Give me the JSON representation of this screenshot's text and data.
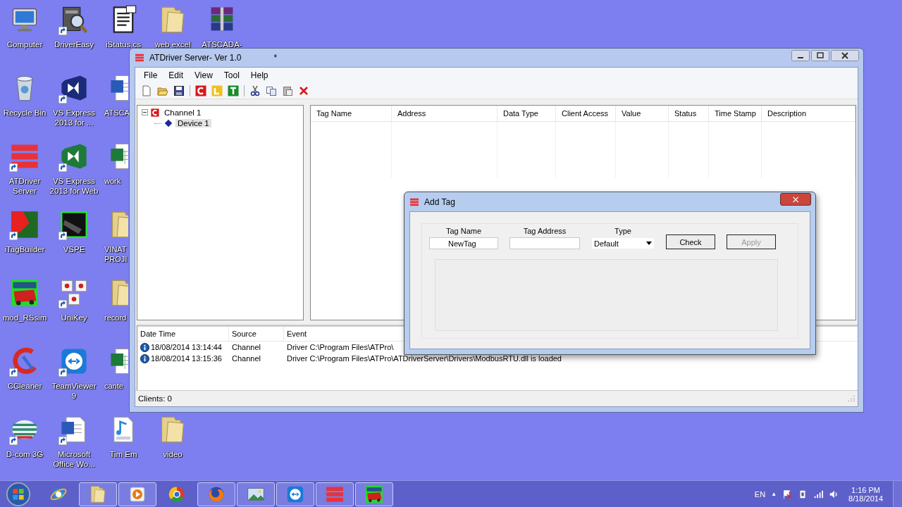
{
  "desktop": {
    "icons": [
      {
        "label": "Computer",
        "kind": "computer",
        "shortcut": false
      },
      {
        "label": "Recycle Bin",
        "kind": "recycle",
        "shortcut": false
      },
      {
        "label": "ATDriver Server",
        "kind": "bars",
        "shortcut": true
      },
      {
        "label": "iTagBuilder",
        "kind": "tagbuilder",
        "shortcut": true
      },
      {
        "label": "mod_RSsim",
        "kind": "mod",
        "shortcut": false
      },
      {
        "label": "CCleaner",
        "kind": "ccleaner",
        "shortcut": true
      },
      {
        "label": "D-com 3G",
        "kind": "globe",
        "shortcut": true
      },
      {
        "label": "DriverEasy",
        "kind": "drivereasy",
        "shortcut": true
      },
      {
        "label": "VS Express 2013 for ...",
        "kind": "vs",
        "shortcut": true
      },
      {
        "label": "VS Express 2013 for Web",
        "kind": "vsweb",
        "shortcut": true
      },
      {
        "label": "VSPE",
        "kind": "vspe",
        "shortcut": true
      },
      {
        "label": "UniKey",
        "kind": "keys",
        "shortcut": true
      },
      {
        "label": "TeamViewer 9",
        "kind": "teamviewer",
        "shortcut": true
      },
      {
        "label": "Microsoft Office Wo...",
        "kind": "word",
        "shortcut": true
      },
      {
        "label": "iStatus.cs",
        "kind": "document",
        "shortcut": false
      },
      {
        "label": "ATSCA",
        "kind": "word",
        "shortcut": false
      },
      {
        "label": "work",
        "kind": "excel",
        "shortcut": false
      },
      {
        "label": "VINAT PROJI",
        "kind": "folder",
        "shortcut": false
      },
      {
        "label": "record",
        "kind": "folder",
        "shortcut": false
      },
      {
        "label": "cante",
        "kind": "excel",
        "shortcut": false
      },
      {
        "label": "Tim Em",
        "kind": "mp3",
        "shortcut": false
      },
      {
        "label": "web excel",
        "kind": "folder",
        "shortcut": false
      },
      {
        "label": "video",
        "kind": "folder",
        "shortcut": false
      },
      {
        "label": "ATSCADA-",
        "kind": "archive",
        "shortcut": false
      }
    ]
  },
  "window": {
    "title": "ATDriver Server- Ver 1.0",
    "modified_mark": "*"
  },
  "menu": [
    "File",
    "Edit",
    "View",
    "Tool",
    "Help"
  ],
  "tree": [
    {
      "label": "Channel 1",
      "selected": false,
      "expanded": true,
      "children": [
        {
          "label": "Device 1",
          "selected": true
        }
      ]
    }
  ],
  "tag_table": {
    "columns": [
      "Tag Name",
      "Address",
      "Data Type",
      "Client Access",
      "Value",
      "Status",
      "Time Stamp",
      "Description"
    ]
  },
  "log": {
    "columns": [
      "Date Time",
      "Source",
      "Event"
    ],
    "rows": [
      {
        "time": "18/08/2014 13:14:44",
        "source": "Channel",
        "event": "Driver C:\\Program Files\\ATPro\\"
      },
      {
        "time": "18/08/2014 13:15:36",
        "source": "Channel",
        "event": "Driver C:\\Program Files\\ATPro\\ATDriverServer\\Drivers\\ModbusRTU.dll is loaded"
      }
    ]
  },
  "status_bar": "Clients: 0",
  "dialog": {
    "title": "Add Tag",
    "close": "×",
    "fields": [
      {
        "label": "Tag Name",
        "value": "NewTag"
      },
      {
        "label": "Tag Address"
      }
    ],
    "type": {
      "label": "Type",
      "value": "Default"
    },
    "buttons": [
      {
        "label": "Check",
        "disabled": false
      },
      {
        "label": "Apply",
        "disabled": true
      }
    ]
  },
  "taskbar": {
    "apps": [
      {
        "kind": "ie",
        "open": false
      },
      {
        "kind": "folder",
        "open": true
      },
      {
        "kind": "media",
        "open": true
      },
      {
        "kind": "chrome",
        "open": false
      },
      {
        "kind": "firefox",
        "open": true
      },
      {
        "kind": "picture",
        "open": true
      },
      {
        "kind": "teamviewer",
        "open": true
      },
      {
        "kind": "bars",
        "open": true
      },
      {
        "kind": "mod",
        "open": true
      }
    ],
    "language": "EN",
    "tray_arrow": "▲",
    "time": "1:16 PM",
    "date": "8/18/2014"
  }
}
